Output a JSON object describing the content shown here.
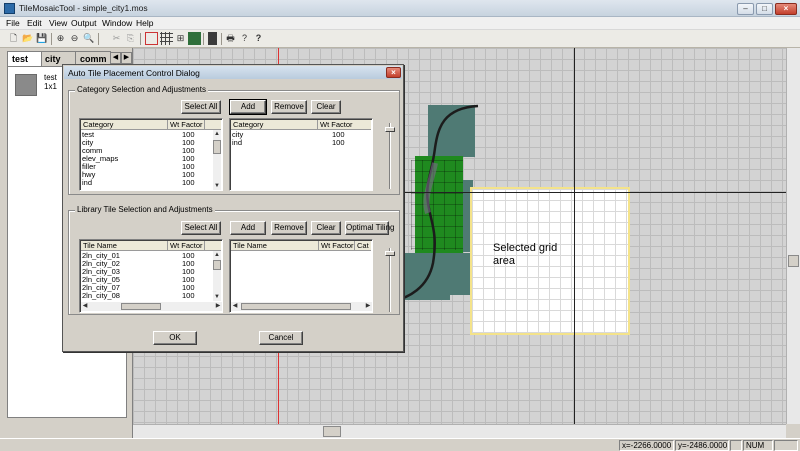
{
  "window": {
    "title": "TileMosaicTool - simple_city1.mos",
    "controls": {
      "minimize": "–",
      "maximize": "□",
      "close": "×"
    }
  },
  "menu": [
    "File",
    "Edit",
    "View",
    "Output",
    "Window",
    "Help"
  ],
  "toolbar": {
    "icons": [
      "new-icon",
      "open-icon",
      "save-icon",
      "zoom-in-icon",
      "zoom-out-icon",
      "zoom-fit-icon",
      "zoom-select-icon",
      "cut-icon",
      "copy-icon",
      "delete-icon",
      "rectangle-icon",
      "grid-icon",
      "tile-view-icon",
      "mosaic-icon",
      "output-icon",
      "print-icon",
      "help-icon",
      "context-help-icon"
    ]
  },
  "left_panel": {
    "tabs": [
      {
        "label": "test",
        "active": true
      },
      {
        "label": "city",
        "active": false
      },
      {
        "label": "comm",
        "active": false
      }
    ],
    "tile": {
      "name": "test",
      "size": "1x1"
    }
  },
  "canvas": {
    "selection_label": "Selected grid area",
    "colors": {
      "grid_bg": "#d3d3d3",
      "selection": "#ffffff",
      "selection_border": "#f4e38a",
      "tile_teal": "#4f7a74",
      "tile_green": "#1f8a1f",
      "road": "#1c1c1c"
    }
  },
  "dialog": {
    "title": "Auto Tile Placement Control Dialog",
    "close": "×",
    "category_group": {
      "label": "Category Selection and Adjustments",
      "select_all": "Select All",
      "add": "Add",
      "remove": "Remove",
      "clear": "Clear",
      "left_list": {
        "columns": [
          "Category",
          "Wt Factor"
        ],
        "rows": [
          [
            "test",
            "100"
          ],
          [
            "city",
            "100"
          ],
          [
            "comm",
            "100"
          ],
          [
            "elev_maps",
            "100"
          ],
          [
            "filler",
            "100"
          ],
          [
            "hwy",
            "100"
          ],
          [
            "ind",
            "100"
          ]
        ]
      },
      "right_list": {
        "columns": [
          "Category",
          "Wt Factor"
        ],
        "rows": [
          [
            "city",
            "100"
          ],
          [
            "ind",
            "100"
          ]
        ]
      }
    },
    "library_group": {
      "label": "Library Tile Selection and Adjustments",
      "select_all": "Select All",
      "add": "Add",
      "remove": "Remove",
      "clear": "Clear",
      "optimal": "Optimal Tiling",
      "left_list": {
        "columns": [
          "Tile Name",
          "Wt Factor"
        ],
        "rows": [
          [
            "2ln_city_01",
            "100"
          ],
          [
            "2ln_city_02",
            "100"
          ],
          [
            "2ln_city_03",
            "100"
          ],
          [
            "2ln_city_05",
            "100"
          ],
          [
            "2ln_city_07",
            "100"
          ],
          [
            "2ln_city_08",
            "100"
          ]
        ]
      },
      "right_list": {
        "columns": [
          "Tile Name",
          "Wt Factor",
          "Cat"
        ],
        "rows": []
      }
    },
    "ok": "OK",
    "cancel": "Cancel"
  },
  "status": {
    "x": "x=-2266.0000",
    "y": "y=-2486.0000",
    "num": "NUM"
  }
}
